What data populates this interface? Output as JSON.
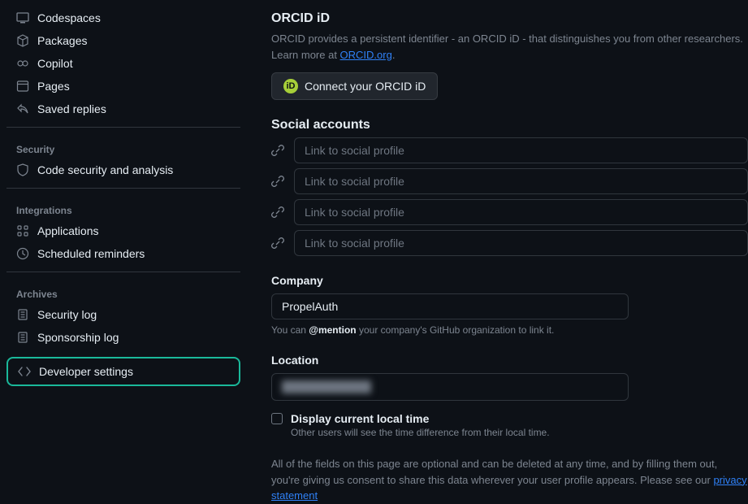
{
  "sidebar": {
    "top": [
      {
        "label": "Codespaces",
        "icon": "codespaces"
      },
      {
        "label": "Packages",
        "icon": "package"
      },
      {
        "label": "Copilot",
        "icon": "copilot"
      },
      {
        "label": "Pages",
        "icon": "browser"
      },
      {
        "label": "Saved replies",
        "icon": "reply"
      }
    ],
    "security_heading": "Security",
    "security": [
      {
        "label": "Code security and analysis",
        "icon": "shield"
      }
    ],
    "integrations_heading": "Integrations",
    "integrations": [
      {
        "label": "Applications",
        "icon": "apps"
      },
      {
        "label": "Scheduled reminders",
        "icon": "clock"
      }
    ],
    "archives_heading": "Archives",
    "archives": [
      {
        "label": "Security log",
        "icon": "log"
      },
      {
        "label": "Sponsorship log",
        "icon": "log"
      }
    ],
    "developer_settings": {
      "label": "Developer settings",
      "icon": "code"
    }
  },
  "orcid": {
    "title": "ORCID iD",
    "desc_1": "ORCID provides a persistent identifier - an ORCID iD - that distinguishes you from other researchers. Learn more at ",
    "link_label": "ORCID.org",
    "desc_2": ".",
    "button": "Connect your ORCID iD"
  },
  "social": {
    "title": "Social accounts",
    "placeholder": "Link to social profile"
  },
  "company": {
    "title": "Company",
    "value": "PropelAuth",
    "hint_1": "You can ",
    "hint_mention": "@mention",
    "hint_2": " your company's GitHub organization to link it."
  },
  "location": {
    "title": "Location",
    "check_label": "Display current local time",
    "sub": "Other users will see the time difference from their local time."
  },
  "footer": {
    "text_1": "All of the fields on this page are optional and can be deleted at any time, and by filling them out, you're giving us consent to share this data wherever your user profile appears. Please see our ",
    "link": "privacy statement"
  }
}
